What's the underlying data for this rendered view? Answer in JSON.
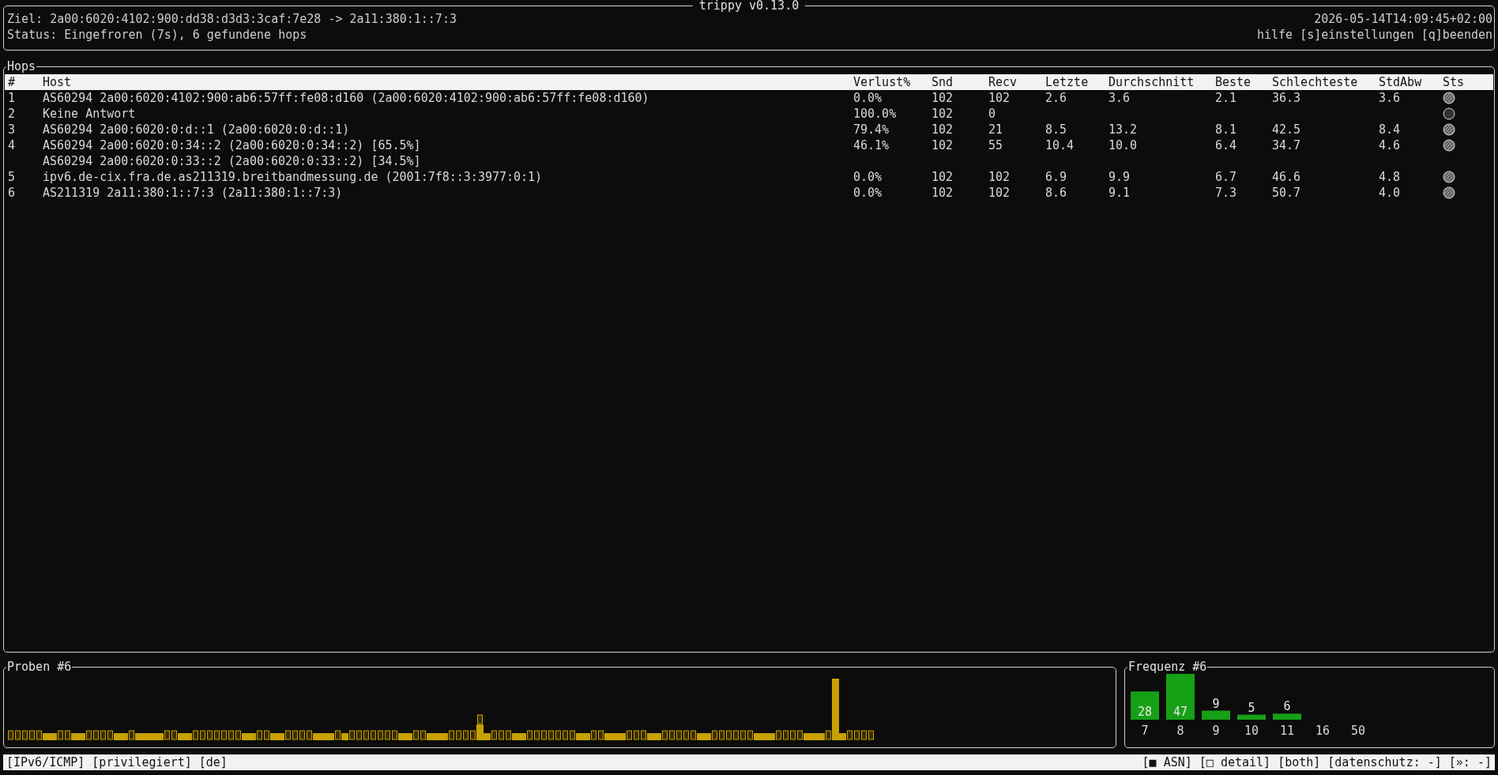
{
  "app": {
    "title": "trippy v0.13.0"
  },
  "header": {
    "target": "Ziel: 2a00:6020:4102:900:dd38:d3d3:3caf:7e28 -> 2a11:380:1::7:3",
    "status": "Status: Eingefroren (7s), 6 gefundene hops",
    "timestamp": "2026-05-14T14:09:45+02:00",
    "help": "hilfe [s]einstellungen [q]beenden"
  },
  "hops": {
    "title": "Hops",
    "columns": [
      "#",
      "Host",
      "Verlust%",
      "Snd",
      "Recv",
      "Letzte",
      "Durchschnitt",
      "Beste",
      "Schlechteste",
      "StdAbw",
      "Sts"
    ],
    "rows": [
      {
        "number": "1",
        "hosts": [
          "AS60294 2a00:6020:4102:900:ab6:57ff:fe08:d160 (2a00:6020:4102:900:ab6:57ff:fe08:d160)"
        ],
        "loss": "0.0%",
        "snd": "102",
        "recv": "102",
        "last": "2.6",
        "avg": "3.6",
        "best": "2.1",
        "worst": "36.3",
        "stddev": "3.6",
        "responding": true
      },
      {
        "number": "2",
        "hosts": [
          "Keine Antwort"
        ],
        "loss": "100.0%",
        "snd": "102",
        "recv": "0",
        "responding": false
      },
      {
        "number": "3",
        "hosts": [
          "AS60294 2a00:6020:0:d::1 (2a00:6020:0:d::1)"
        ],
        "loss": "79.4%",
        "snd": "102",
        "recv": "21",
        "last": "8.5",
        "avg": "13.2",
        "best": "8.1",
        "worst": "42.5",
        "stddev": "8.4",
        "responding": true
      },
      {
        "number": "4",
        "hosts": [
          "AS60294 2a00:6020:0:34::2 (2a00:6020:0:34::2) [65.5%]",
          "AS60294 2a00:6020:0:33::2 (2a00:6020:0:33::2) [34.5%]"
        ],
        "loss": "46.1%",
        "snd": "102",
        "recv": "55",
        "last": "10.4",
        "avg": "10.0",
        "best": "6.4",
        "worst": "34.7",
        "stddev": "4.6",
        "responding": true
      },
      {
        "number": "5",
        "hosts": [
          "ipv6.de-cix.fra.de.as211319.breitbandmessung.de (2001:7f8::3:3977:0:1)"
        ],
        "loss": "0.0%",
        "snd": "102",
        "recv": "102",
        "last": "6.9",
        "avg": "9.9",
        "best": "6.7",
        "worst": "46.6",
        "stddev": "4.8",
        "responding": true
      },
      {
        "number": "6",
        "hosts": [
          "AS211319 2a11:380:1::7:3 (2a11:380:1::7:3)"
        ],
        "loss": "0.0%",
        "snd": "102",
        "recv": "102",
        "last": "8.6",
        "avg": "9.1",
        "best": "7.3",
        "worst": "50.7",
        "stddev": "4.0",
        "responding": true
      }
    ]
  },
  "samples": {
    "title": "Proben #6"
  },
  "frequency": {
    "title": "Frequenz #6",
    "chart_data": {
      "type": "bar",
      "categories": [
        "7",
        "8",
        "9",
        "10",
        "11",
        "16",
        "50"
      ],
      "values": [
        28,
        47,
        9,
        5,
        6,
        null,
        null
      ],
      "data_labels": true
    }
  },
  "status_bar": {
    "left": [
      "[IPv6/ICMP]",
      "[privilegiert]",
      "[de]"
    ],
    "right": [
      "[■ ASN]",
      "[□ detail]",
      "[both]",
      "[datenschutz: -]",
      "[»: -]"
    ]
  }
}
